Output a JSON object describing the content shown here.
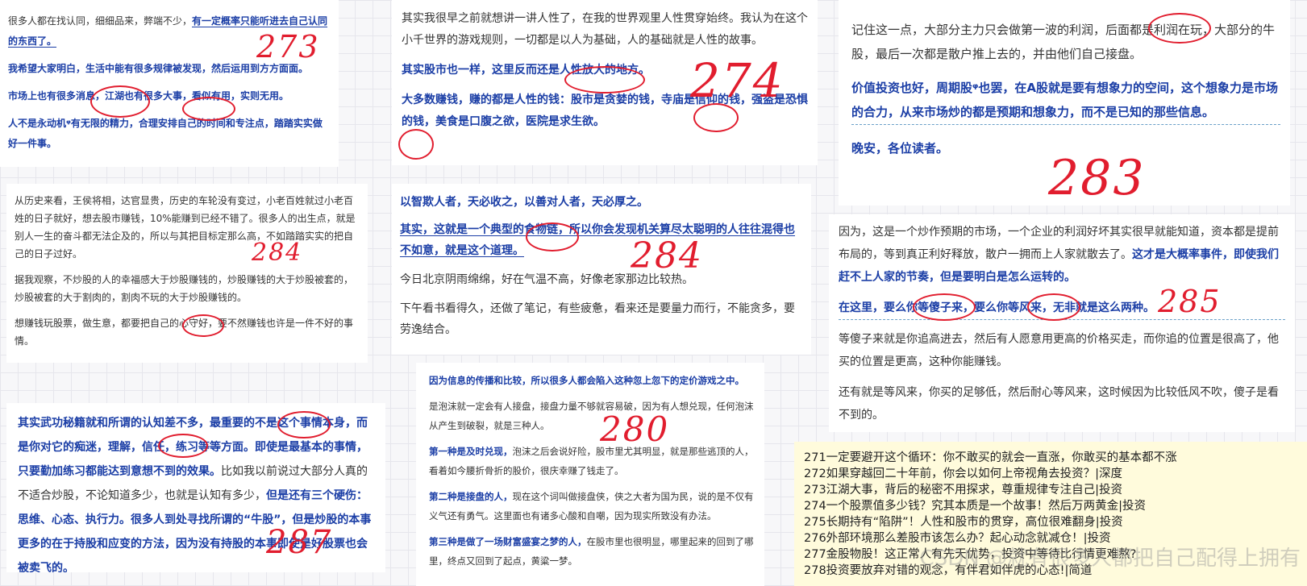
{
  "c1": {
    "p1a": "很多人都在找认同，细细品来，弊端不少，",
    "p1b": "有一定概率只能听进去自己认同的东西了。",
    "p2": "我希望大家明白，生活中能有很多规律被发现，然后运用到方方面面。",
    "p3": "市场上也有很多消息，江湖也有很多大事，看似有用，实则无用。",
    "p4": "人不是永动机ᵠ有无限的精力，合理安排自己的时间和专注点，踏踏实实做好一件事。",
    "mark": "273"
  },
  "c2": {
    "p1": "其实我很早之前就想讲一讲人性了，在我的世界观里人性贯穿始终。我认为在这个小千世界的游戏规则，一切都是以人为基础，人的基础就是人性的故事。",
    "p2": "其实股市也一样，这里反而还是人性放大的地方。",
    "p3": "大多数赚钱，赚的都是人性的钱：股市是贪婪的钱，寺庙是信仰的钱，强盗是恐惧的钱，美食是口腹之欲，医院是求生欲。",
    "mark": "274"
  },
  "c3": {
    "p1": "记住这一点，大部分主力只会做第一波的利润，后面都是利润在玩，大部分的牛股，最后一次都是散户推上去的，并由他们自己接盘。",
    "p2": "价值投资也好，周期股ᵠ也罢，在A股就是要有想象力的空间，这个想象力是市场的合力，从来市场炒的都是预期和想象力，而不是已知的那些信息。",
    "p3": "晚安，各位读者。",
    "mark": "283"
  },
  "c4": {
    "p1": "从历史来看，王侯将相，达官显贵，历史的车轮没有变过，小老百姓就过小老百姓的日子就好，想去股市赚钱，10%能赚到已经不错了。很多人的出生点，就是别人一生的奋斗都无法企及的，所以与其把目标定那么高，不如踏踏实实的把自己的日子过好。",
    "p2": "据我观察，不炒股的人的幸福感大于炒股赚钱的，炒股赚钱的大于炒股被套的，炒股被套的大于割肉的，割肉不玩的大于炒股赚钱的。",
    "p3": "想赚钱玩股票，做生意，都要把自己的心守好，要不然赚钱也许是一件不好的事情。",
    "mark": "284"
  },
  "c5": {
    "p1": "以智欺人者，天必收之，以善对人者，天必厚之。",
    "p2": "其实，这就是一个典型的食物链，所以你会发现机关算尽太聪明的人往往混得也不如意，就是这个道理。",
    "p3": "今日北京阴雨绵绵，好在气温不高，好像老家那边比较热。",
    "p4": "下午看书看得久，还做了笔记，有些疲惫，看来还是要量力而行，不能贪多，要劳逸结合。",
    "mark": "284"
  },
  "c6": {
    "p1": "因为，这是一个炒作预期的市场，一个企业的利润好坏其实很早就能知道，资本都是提前布局的，等到真正利好释放，散户一拥而上人家就散去了。",
    "p1b": "这才是大概率事件，即使我们赶不上人家的节奏，但是要明白是怎么运转的。",
    "p2": "在这里，要么你等傻子来，要么你等风来，无非就是这么两种。",
    "p3": "等傻子来就是你追高进去，然后有人愿意用更高的价格买走，而你追的位置是很高了，他买的位置是更高，这种你能赚钱。",
    "p4": "还有就是等风来，你买的足够低，然后耐心等风来，这时候因为比较低风不吹，傻子是看不到的。",
    "mark": "285"
  },
  "c7": {
    "p1a": "其实武功秘籍就和所谓的认知差不多，最重要的不是这个事情本身，而是你对它的痴迷，理解，信任，练习等等方面。即使是最基本的事情，只要勤加练习都能达到意想不到的效果。",
    "p1b": "比如我以前说过大部分人真的不适合炒股，不论知道多少，也就是认知有多少，",
    "p1c": "但是还有三个硬伤：思维、心态、执行力。很多人到处寻找所谓的“牛股”，但是炒股的本事更多的在于持股和应变的方法，因为没有持股的本事即使是好股票也会被卖飞的。",
    "mark": "287"
  },
  "c8": {
    "p1": "因为信息的传播和比较，所以很多人都会陷入这种忽上忽下的定价游戏之中。",
    "p2": "是泡沫就一定会有人接盘，接盘力量不够就容易破，因为有人想兑现，任何泡沫从产生到破裂，就是三种人。",
    "p3a": "第一种是及时兑现，",
    "p3b": "泡沫之后会说好险，股市里尤其明显，就是那些逃顶的人，看着如今腰折骨折的股价，很庆幸赚了钱走了。",
    "p4a": "第二种是接盘的人，",
    "p4b": "现在这个词叫做接盘侠，侠之大者为国为民，说的是不仅有义气还有勇气。这里面也有诸多心酸和自嘲，因为现实所致没有办法。",
    "p5a": "第三种是做了一场财富盛宴之梦的人，",
    "p5b": "在股市里也很明显，哪里起来的回到了哪里，终点又回到了起点，黄粱一梦。",
    "mark": "280"
  },
  "note": {
    "items": [
      "271一定要避开这个循环：你不敢买的就会一直涨，你敢买的基本都不涨",
      "272如果穿越回二十年前，你会以如何上帝视角去投资？|深度",
      "273江湖大事，背后的秘密不用探求，尊重规律专注自己|投资",
      "274一个股票值多少钱？究其本质是一个故事！然后万两黄金|投资",
      "275长期持有“陷阱”！人性和股市的贯穿，高位很难翻身|投资",
      "276外部环境那么差股市该怎么办？起心动念就减仓！|投资",
      "277金股物股！这正常人有先天优势，投资中等待比行情更难熬?",
      "278投资要放弃对错的观念，有伴君如伴虎的心态!|简道"
    ]
  },
  "watermark": "CSDN @就有很多人都把自己配得上拥有"
}
